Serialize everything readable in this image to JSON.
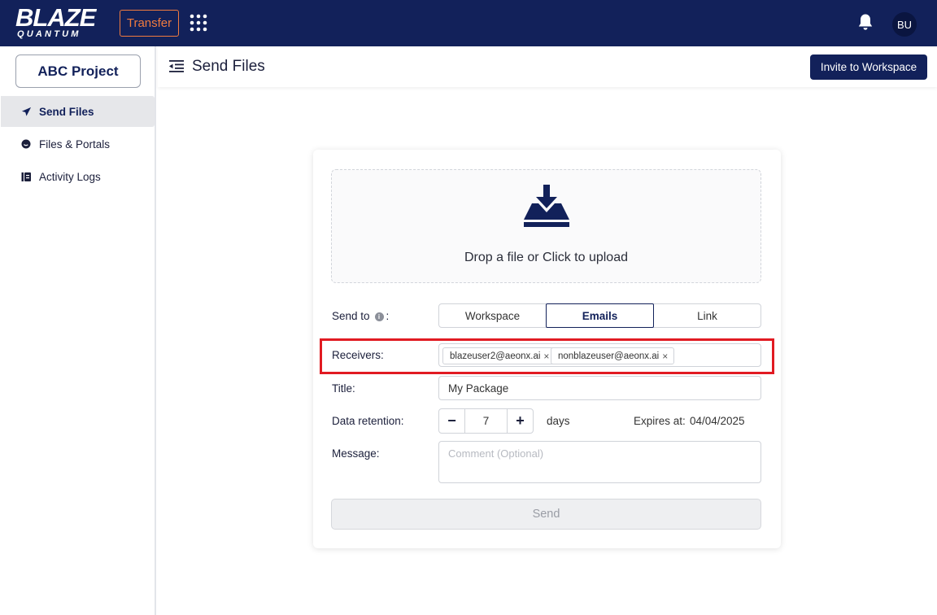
{
  "topbar": {
    "logo_line1": "BLAZE",
    "logo_line2": "QUANTUM",
    "transfer_label": "Transfer",
    "avatar_initials": "BU",
    "background_color": "#12215a",
    "accent_color": "#f07b3f"
  },
  "sidebar": {
    "project_label": "ABC Project",
    "items": [
      {
        "label": "Send Files",
        "icon": "send-icon",
        "active": true
      },
      {
        "label": "Files & Portals",
        "icon": "portal-icon",
        "active": false
      },
      {
        "label": "Activity Logs",
        "icon": "log-icon",
        "active": false
      }
    ]
  },
  "header": {
    "title": "Send Files",
    "invite_label": "Invite to Workspace"
  },
  "upload": {
    "prompt": "Drop a file or Click to upload"
  },
  "form": {
    "send_to_label": "Send to",
    "send_to_colon": ":",
    "send_to_options": [
      "Workspace",
      "Emails",
      "Link"
    ],
    "send_to_selected": "Emails",
    "receivers_label": "Receivers:",
    "receivers": [
      "blazeuser2@aeonx.ai",
      "nonblazeuser@aeonx.ai"
    ],
    "title_label": "Title:",
    "title_value": "My Package",
    "retention_label": "Data retention:",
    "retention_value": "7",
    "retention_minus": "−",
    "retention_plus": "+",
    "retention_unit": "days",
    "expires_label": "Expires at:",
    "expires_value": "04/04/2025",
    "message_label": "Message:",
    "message_placeholder": "Comment (Optional)",
    "send_label": "Send",
    "highlight_color": "#e11b22"
  }
}
